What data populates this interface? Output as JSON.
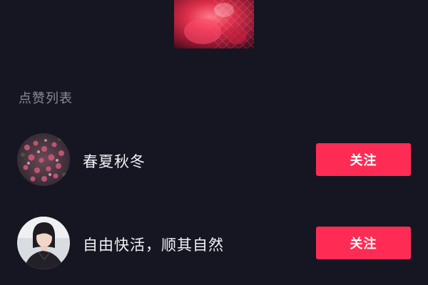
{
  "header": {
    "cover_icon": "video-cover-thumbnail"
  },
  "likes": {
    "title": "点赞列表",
    "users": [
      {
        "name": "春夏秋冬",
        "follow_label": "关注",
        "avatar_icon": "flowers-avatar"
      },
      {
        "name": "自由快活，顺其自然",
        "follow_label": "关注",
        "avatar_icon": "person-avatar"
      }
    ]
  },
  "colors": {
    "background": "#161622",
    "accent": "#fe2c55",
    "section_title": "#8a8b96",
    "text": "#f2f2f6"
  }
}
